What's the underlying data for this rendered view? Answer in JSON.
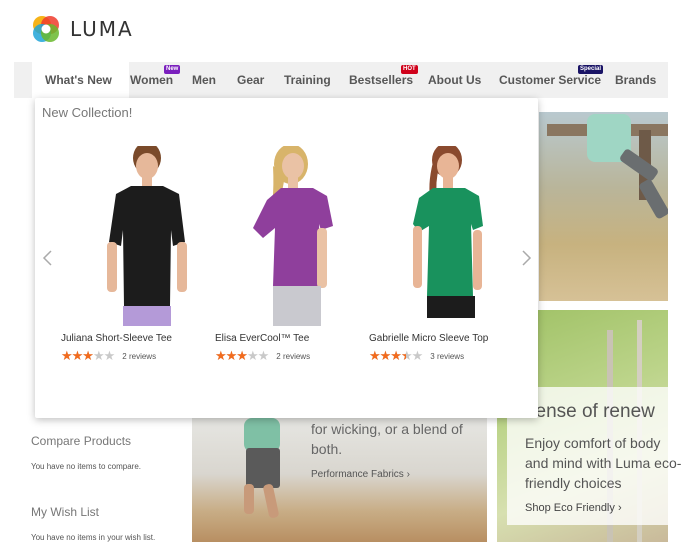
{
  "brand": {
    "name": "LUMA"
  },
  "colors": {
    "accent": "#f26b1d",
    "new_badge": "#7a1fbd",
    "hot_badge": "#d0021b",
    "special_badge": "#1a1466"
  },
  "nav": {
    "items": [
      {
        "label": "What's New",
        "active": true
      },
      {
        "label": "Women",
        "badge": "New"
      },
      {
        "label": "Men"
      },
      {
        "label": "Gear"
      },
      {
        "label": "Training"
      },
      {
        "label": "Bestsellers",
        "badge": "HOT"
      },
      {
        "label": "About Us"
      },
      {
        "label": "Customer Service",
        "badge": "Special"
      },
      {
        "label": "Brands"
      }
    ]
  },
  "dropdown": {
    "title": "New Collection!",
    "products": [
      {
        "name": "Juliana Short-Sleeve Tee",
        "rating": 0.6,
        "reviews": "2 reviews",
        "shirt_color": "#1c1c1c"
      },
      {
        "name": "Elisa EverCool™ Tee",
        "rating": 0.6,
        "reviews": "2 reviews",
        "shirt_color": "#8f3f9c"
      },
      {
        "name": "Gabrielle Micro Sleeve Top",
        "rating": 0.7,
        "reviews": "3 reviews",
        "shirt_color": "#19925d"
      }
    ]
  },
  "promo_performance": {
    "text": "for wicking, or a blend of both.",
    "link": "Performance Fabrics"
  },
  "promo_eco": {
    "title": "sense of renew",
    "text": "Enjoy comfort of body and mind with Luma eco-friendly choices",
    "link": "Shop Eco Friendly"
  },
  "sidebar": {
    "compare_title": "Compare Products",
    "compare_empty": "You have no items to compare.",
    "wishlist_title": "My Wish List",
    "wishlist_empty": "You have no items in your wish list."
  }
}
